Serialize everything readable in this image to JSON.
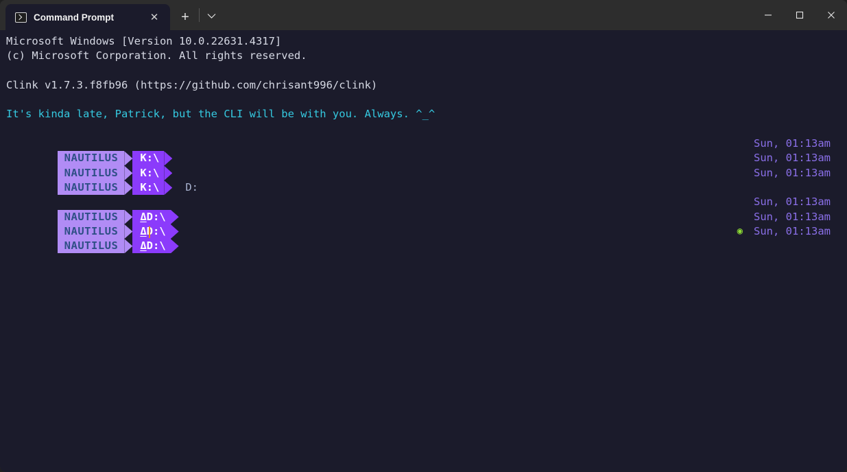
{
  "window": {
    "title": "Command Prompt",
    "controls": {
      "minimize": "minimize",
      "maximize": "maximize",
      "close": "close"
    }
  },
  "tabbar": {
    "tab_label": "Command Prompt",
    "close_label": "✕",
    "new_tab_label": "+",
    "dropdown_label": "⌄"
  },
  "terminal": {
    "lines": {
      "version": "Microsoft Windows [Version 10.0.22631.4317]",
      "copyright": "(c) Microsoft Corporation. All rights reserved.",
      "clink": "Clink v1.7.3.f8fb96 (https://github.com/chrisant996/clink)",
      "greeting": "It's kinda late, Patrick, but the CLI will be with you. Always. ^_^"
    },
    "prompt_block_1": {
      "host": "NAUTILUS",
      "path": "K:\\",
      "command": "D:"
    },
    "prompt_block_2": {
      "host": "NAUTILUS",
      "marker": "Δ",
      "path": "D:\\",
      "command": ""
    },
    "timestamp": "Sun, 01:13am",
    "status_dot": "◉",
    "colors": {
      "background": "#1b1b2b",
      "segment_host_bg": "#b18cf5",
      "segment_host_fg": "#2f4f86",
      "segment_path_bg": "#8b3bfb",
      "segment_path_fg": "#ffffff",
      "timestamp_fg": "#8a6fe8",
      "greeting_fg": "#35c9e0",
      "status_dot_fg": "#8ddc34",
      "cursor_fg": "#e08a1e"
    }
  }
}
